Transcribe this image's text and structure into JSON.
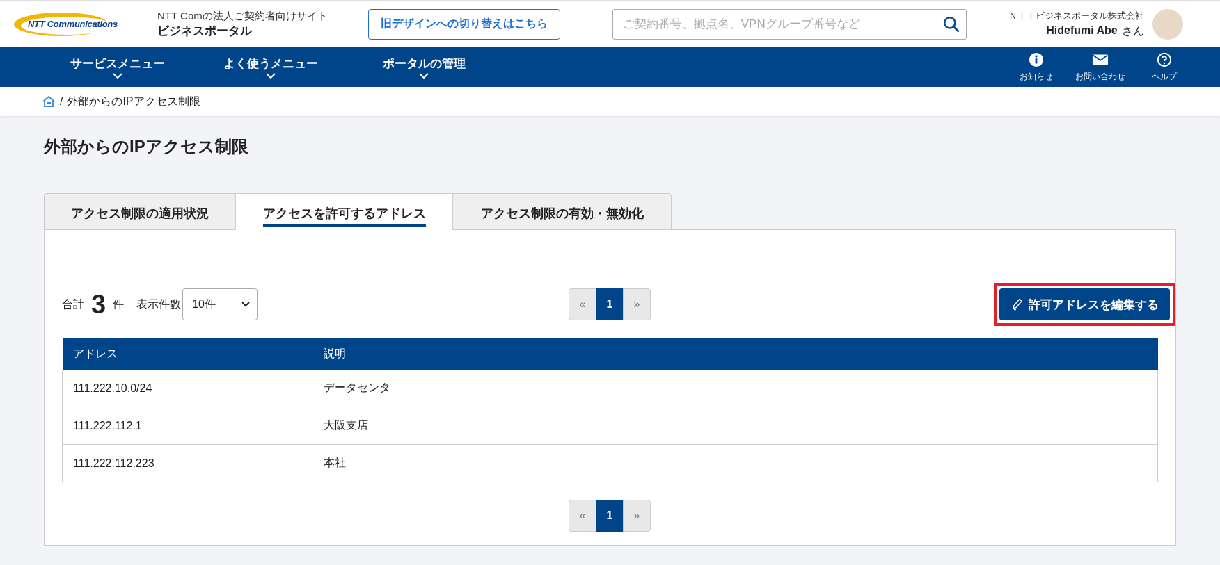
{
  "header": {
    "logo_text": "NTT Communications",
    "site_caption": "NTT Comの法人ご契約者向けサイト",
    "site_name": "ビジネスポータル",
    "old_design_link": "旧デザインへの切り替えはこちら",
    "search": {
      "placeholder": "ご契約番号、拠点名、VPNグループ番号など"
    },
    "company": "ＮＴＴビジネスポータル株式会社",
    "user_name": "Hidefumi Abe",
    "honorific": "さん"
  },
  "nav": {
    "menus": [
      "サービスメニュー",
      "よく使うメニュー",
      "ポータルの管理"
    ],
    "icons": [
      {
        "kind": "info",
        "label": "お知らせ"
      },
      {
        "kind": "mail",
        "label": "お問い合わせ"
      },
      {
        "kind": "help",
        "label": "ヘルプ"
      }
    ]
  },
  "breadcrumb": {
    "separator": "/",
    "current": "外部からのIPアクセス制限"
  },
  "page_title": "外部からのIPアクセス制限",
  "tabs": [
    {
      "label": "アクセス制限の適用状況",
      "selected": false
    },
    {
      "label": "アクセスを許可するアドレス",
      "selected": true
    },
    {
      "label": "アクセス制限の有効・無効化",
      "selected": false
    }
  ],
  "summary": {
    "total_label": "合計",
    "total": "3",
    "total_unit": "件",
    "per_page_label": "表示件数",
    "per_page": "10件"
  },
  "pagination": {
    "prev": "«",
    "pages": [
      {
        "label": "1",
        "selected": true
      }
    ],
    "next": "»"
  },
  "bottom_pagination": {
    "prev": "«",
    "pages": [
      {
        "label": "1",
        "selected": true
      }
    ],
    "next": "»"
  },
  "edit_button": {
    "label": "許可アドレスを編集する",
    "highlighted": true
  },
  "table": {
    "columns": [
      "アドレス",
      "説明"
    ],
    "rows": [
      [
        "111.222.10.0/24",
        "データセンタ"
      ],
      [
        "111.222.112.1",
        "大阪支店"
      ],
      [
        "111.222.112.223",
        "本社"
      ]
    ]
  }
}
